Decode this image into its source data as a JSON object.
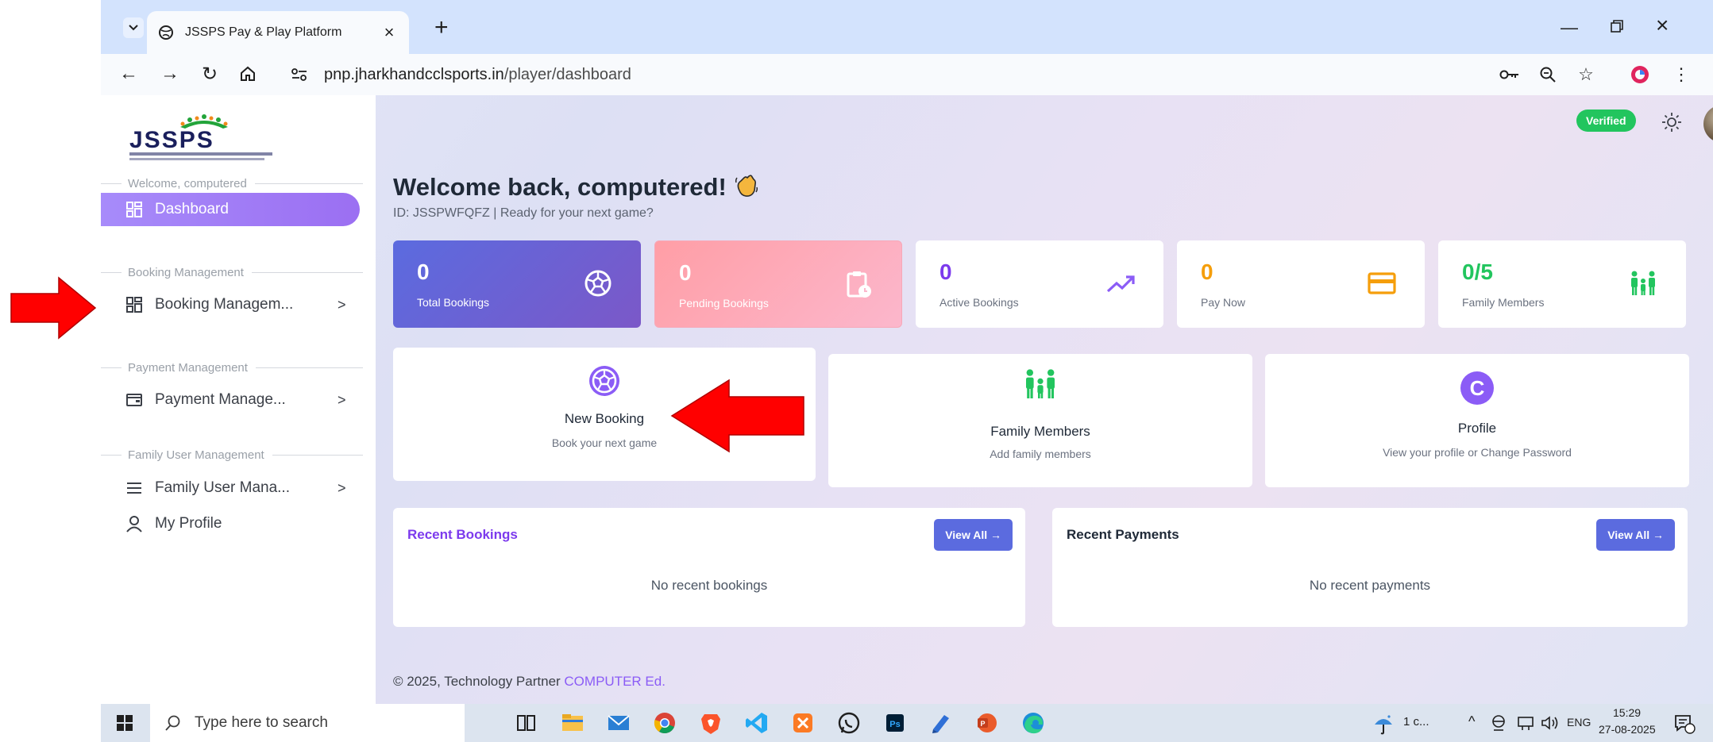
{
  "browser": {
    "tab_title": "JSSPS Pay & Play Platform",
    "url_prefix": "pnp.",
    "url_host": "jharkhandcclsports.in",
    "url_path": "/player/dashboard"
  },
  "sidebar": {
    "welcome_label": "Welcome, computered",
    "dashboard": "Dashboard",
    "sections": [
      {
        "label": "Booking Management",
        "item": "Booking Managem..."
      },
      {
        "label": "Payment Management",
        "item": "Payment Manage..."
      },
      {
        "label": "Family User Management",
        "item": "Family User Mana..."
      }
    ],
    "my_profile": "My Profile"
  },
  "header": {
    "verified": "Verified"
  },
  "main": {
    "welcome_title": "Welcome back, computered!",
    "subline": "ID: JSSPWFQFZ | Ready for your next game?",
    "stats": [
      {
        "value": "0",
        "label": "Total Bookings"
      },
      {
        "value": "0",
        "label": "Pending Bookings"
      },
      {
        "value": "0",
        "label": "Active Bookings"
      },
      {
        "value": "0",
        "label": "Pay Now"
      },
      {
        "value": "0/5",
        "label": "Family Members"
      }
    ],
    "quick": [
      {
        "title": "New Booking",
        "desc": "Book your next game"
      },
      {
        "title": "Family Members",
        "desc": "Add family members"
      },
      {
        "title": "Profile",
        "desc": "View your profile or Change Password"
      }
    ],
    "recent_bookings": {
      "title": "Recent Bookings",
      "button": "View All →",
      "empty": "No recent bookings"
    },
    "recent_payments": {
      "title": "Recent Payments",
      "button": "View All →",
      "empty": "No recent payments"
    },
    "footer_prefix": "© 2025, Technology Partner ",
    "footer_brand": "COMPUTER Ed."
  },
  "taskbar": {
    "search_placeholder": "Type here to search",
    "weather": "1 c...",
    "lang": "ENG",
    "time": "15:29",
    "date": "27-08-2025"
  },
  "colors": {
    "accent_purple": "#8b5cf6",
    "verified_green": "#22c55e",
    "stat_orange": "#f59e0b",
    "annotation_red": "#ff0000"
  }
}
